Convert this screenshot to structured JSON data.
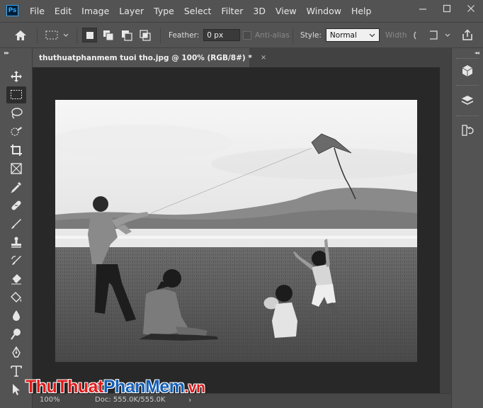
{
  "app": {
    "logo_text": "Ps"
  },
  "menu": [
    "File",
    "Edit",
    "Image",
    "Layer",
    "Type",
    "Select",
    "Filter",
    "3D",
    "View",
    "Window",
    "Help"
  ],
  "options": {
    "feather_label": "Feather:",
    "feather_value": "0 px",
    "antialias_label": "Anti-alias",
    "style_label": "Style:",
    "style_value": "Normal",
    "width_label": "Width"
  },
  "document": {
    "tab_title": "thuthuatphanmem tuoi tho.jpg @ 100% (RGB/8#) *",
    "close_glyph": "×"
  },
  "status": {
    "zoom": "100%",
    "doc_info": "Doc: 555.0K/555.0K",
    "arrow_glyph": "›"
  },
  "watermark": {
    "part1": "Thu",
    "part2": "Thuat",
    "part3": "Phan",
    "part4": "Mem",
    "part5": ".vn"
  },
  "colors": {
    "ui_bg": "#535353",
    "canvas_bg": "#282828",
    "ps_blue": "#31a8ff",
    "wm_red": "#e01b1b",
    "wm_blue": "#1560b8"
  },
  "tools": [
    "move-tool",
    "marquee-tool",
    "lasso-tool",
    "quick-selection-tool",
    "crop-tool",
    "frame-tool",
    "eyedropper-tool",
    "healing-brush-tool",
    "brush-tool",
    "clone-stamp-tool",
    "history-brush-tool",
    "eraser-tool",
    "paint-bucket-tool",
    "blur-tool",
    "dodge-tool",
    "pen-tool",
    "type-tool",
    "path-selection-tool"
  ],
  "right_panels": [
    "3d-panel",
    "layers-panel",
    "history-panel"
  ]
}
